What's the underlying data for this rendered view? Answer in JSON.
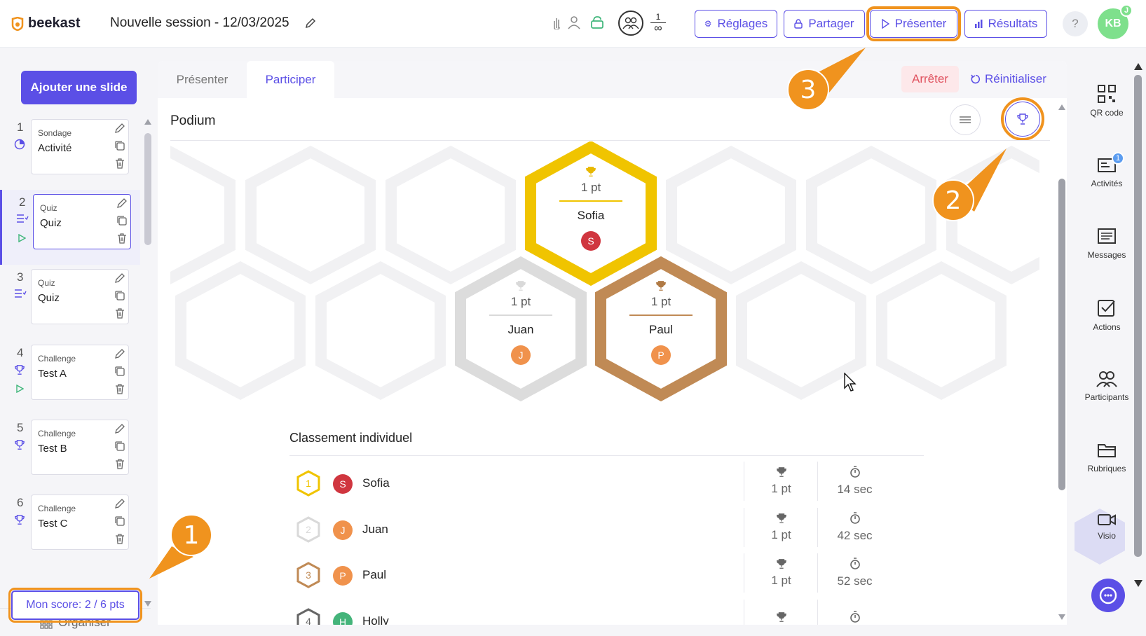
{
  "topbar": {
    "logo_text": "beekast",
    "session_title": "Nouvelle session - 12/03/2025",
    "participants_top": "1",
    "participants_bottom": "∞",
    "buttons": {
      "settings": "Réglages",
      "share": "Partager",
      "present": "Présenter",
      "results": "Résultats"
    },
    "help": "?",
    "avatar_initials": "KB",
    "avatar_badge": "J"
  },
  "sidebar": {
    "add_slide": "Ajouter une slide",
    "slides": [
      {
        "num": "1",
        "type": "Sondage",
        "name": "Activité",
        "icon": "pie-chart-icon",
        "playing": false
      },
      {
        "num": "2",
        "type": "Quiz",
        "name": "Quiz",
        "icon": "quiz-list-icon",
        "playing": true
      },
      {
        "num": "3",
        "type": "Quiz",
        "name": "Quiz",
        "icon": "quiz-list-icon",
        "playing": false
      },
      {
        "num": "4",
        "type": "Challenge",
        "name": "Test A",
        "icon": "trophy-icon",
        "playing": true
      },
      {
        "num": "5",
        "type": "Challenge",
        "name": "Test B",
        "icon": "trophy-icon",
        "playing": false
      },
      {
        "num": "6",
        "type": "Challenge",
        "name": "Test C",
        "icon": "trophy-icon",
        "playing": false
      }
    ],
    "organise": "Organiser",
    "score": "Mon score: 2 / 6 pts"
  },
  "main": {
    "tabs": [
      "Présenter",
      "Participer"
    ],
    "active_tab": "Participer",
    "stop": "Arrêter",
    "reset": "Réinitialiser",
    "podium_title": "Podium",
    "podium": {
      "first": {
        "pts": "1 pt",
        "name": "Sofia",
        "initial": "S"
      },
      "second": {
        "pts": "1 pt",
        "name": "Juan",
        "initial": "J"
      },
      "third": {
        "pts": "1 pt",
        "name": "Paul",
        "initial": "P"
      }
    },
    "ranking_title": "Classement individuel",
    "ranking": [
      {
        "rank": "1",
        "initial": "S",
        "name": "Sofia",
        "pts": "1 pt",
        "time": "14 sec",
        "avatar_color": "#d0363f",
        "hex_color": "#f0c400"
      },
      {
        "rank": "2",
        "initial": "J",
        "name": "Juan",
        "pts": "1 pt",
        "time": "42 sec",
        "avatar_color": "#f0924c",
        "hex_color": "#d9d9d9"
      },
      {
        "rank": "3",
        "initial": "P",
        "name": "Paul",
        "pts": "1 pt",
        "time": "52 sec",
        "avatar_color": "#f0924c",
        "hex_color": "#c08a55"
      },
      {
        "rank": "4",
        "initial": "H",
        "name": "Holly",
        "pts": "",
        "time": "",
        "avatar_color": "#44b47a",
        "hex_color": "#666"
      }
    ]
  },
  "rightbar": {
    "items": [
      {
        "label": "QR code",
        "icon": "qr-code-icon"
      },
      {
        "label": "Activités",
        "icon": "activities-icon",
        "badge": "1"
      },
      {
        "label": "Messages",
        "icon": "messages-icon"
      },
      {
        "label": "Actions",
        "icon": "actions-icon"
      },
      {
        "label": "Participants",
        "icon": "participants-icon"
      },
      {
        "label": "Rubriques",
        "icon": "folder-icon"
      },
      {
        "label": "Visio",
        "icon": "video-icon"
      }
    ]
  },
  "annotations": [
    "1",
    "2",
    "3"
  ],
  "colors": {
    "accent": "#5b4fe6",
    "annotation": "#f0931e",
    "gold": "#f0c400",
    "silver": "#d9d9d9",
    "bronze": "#c08a55",
    "stop_text": "#e0525f"
  }
}
